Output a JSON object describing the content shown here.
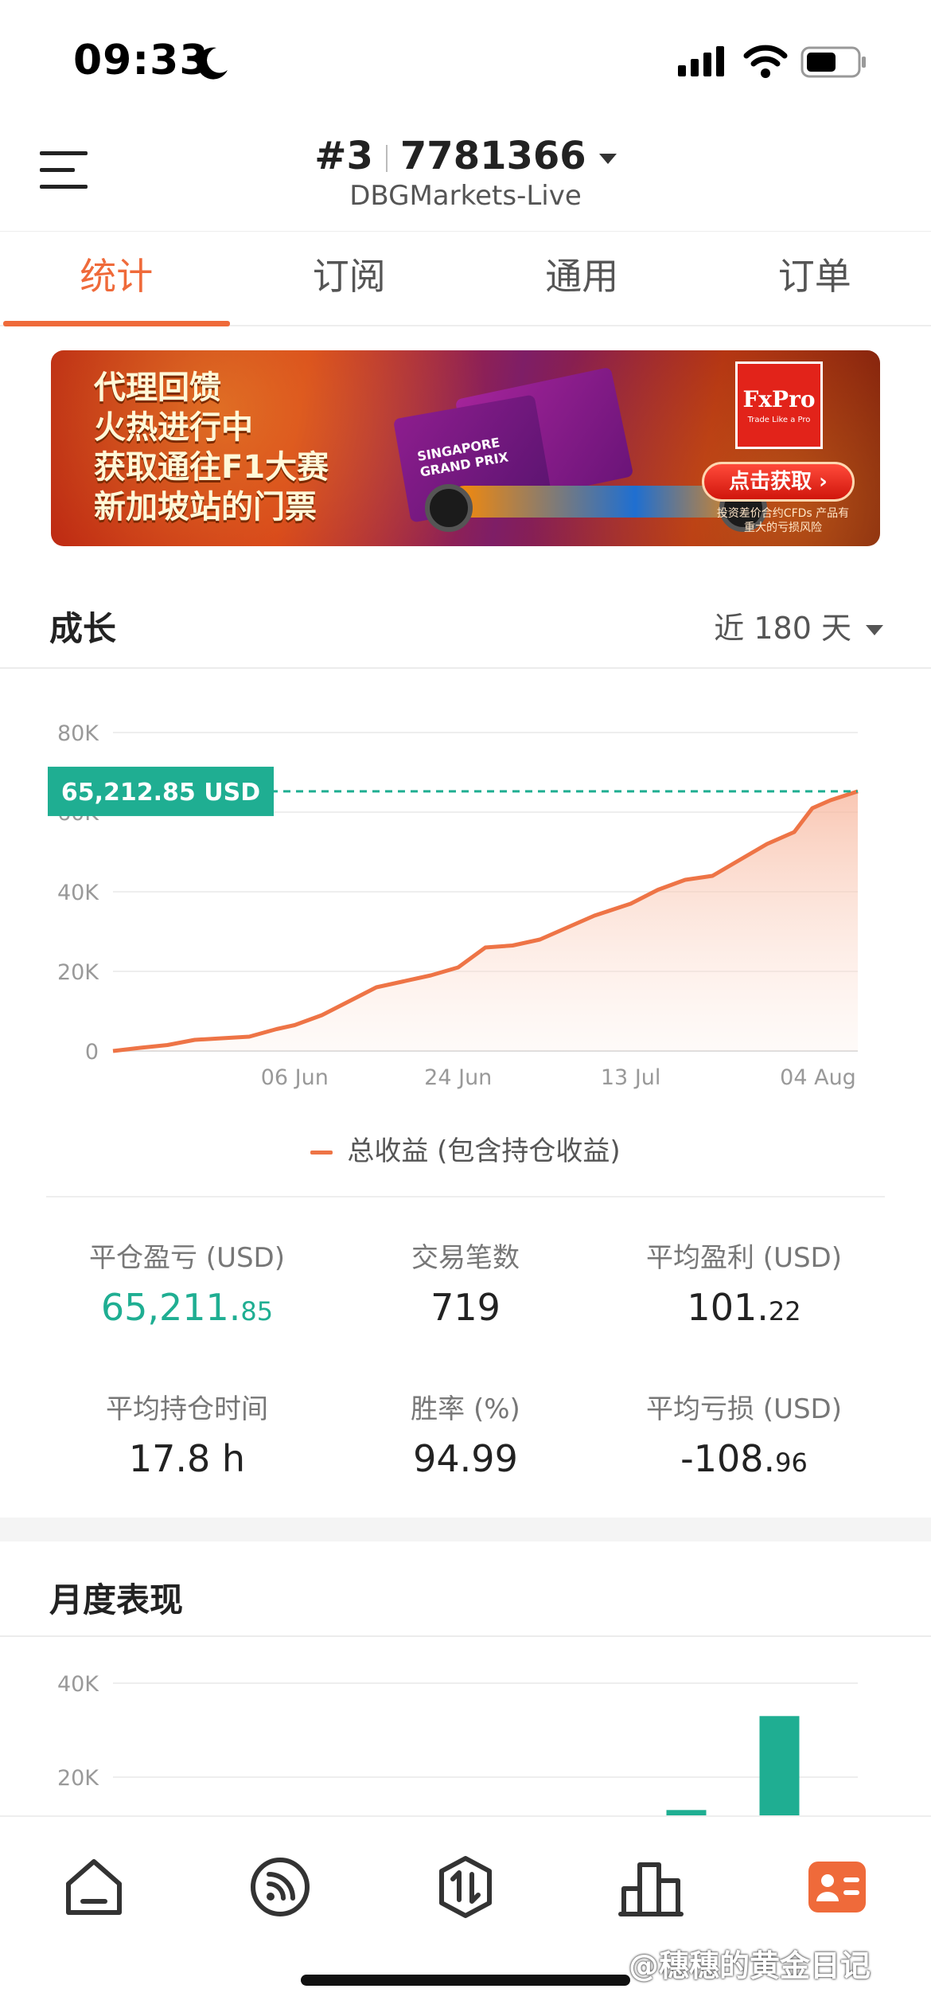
{
  "status_bar": {
    "time": "09:33"
  },
  "header": {
    "account_index": "#3",
    "account_number": "7781366",
    "server": "DBGMarkets-Live"
  },
  "tabs": [
    {
      "label": "统计",
      "active": true
    },
    {
      "label": "订阅",
      "active": false
    },
    {
      "label": "通用",
      "active": false
    },
    {
      "label": "订单",
      "active": false
    }
  ],
  "banner": {
    "lines": [
      "代理回馈",
      "火热进行中",
      "获取通往F1大赛",
      "新加坡站的门票"
    ],
    "ticket_text": "SINGAPORE GRAND PRIX",
    "brand": "FxPro",
    "brand_tagline": "Trade Like a Pro",
    "cta": "点击获取 ›",
    "risk": "投资差价合约CFDs 产品有重大的亏损风险"
  },
  "growth": {
    "title": "成长",
    "range": "近 180 天",
    "current_value_label": "65,212.85 USD",
    "legend": "总收益 (包含持仓收益)"
  },
  "chart_data": [
    {
      "type": "area",
      "title": "",
      "xlabel": "",
      "ylabel": "",
      "ylim": [
        0,
        80000
      ],
      "yticks": [
        "0",
        "20K",
        "40K",
        "60K",
        "80K"
      ],
      "xticks": [
        "06 Jun",
        "24 Jun",
        "13 Jul",
        "04 Aug"
      ],
      "grid": true,
      "line_color": "#ee7446",
      "marker_color": "#1fae92",
      "series": [
        {
          "name": "总收益 (包含持仓收益)",
          "x": [
            "2023-05-17",
            "2023-05-20",
            "2023-05-23",
            "2023-05-26",
            "2023-05-29",
            "2023-06-01",
            "2023-06-04",
            "2023-06-06",
            "2023-06-09",
            "2023-06-12",
            "2023-06-15",
            "2023-06-18",
            "2023-06-21",
            "2023-06-24",
            "2023-06-27",
            "2023-06-30",
            "2023-07-03",
            "2023-07-06",
            "2023-07-09",
            "2023-07-13",
            "2023-07-16",
            "2023-07-19",
            "2023-07-22",
            "2023-07-25",
            "2023-07-28",
            "2023-07-31",
            "2023-08-02",
            "2023-08-04",
            "2023-08-07"
          ],
          "values": [
            0,
            800,
            1500,
            2800,
            3200,
            3600,
            5500,
            6500,
            9000,
            12500,
            16000,
            17500,
            19000,
            21000,
            26000,
            26500,
            28000,
            31000,
            34000,
            37000,
            40500,
            43000,
            44000,
            48000,
            52000,
            55000,
            61000,
            63000,
            65212.85
          ]
        }
      ]
    },
    {
      "type": "bar",
      "title": "",
      "ylim": [
        0,
        40000
      ],
      "yticks": [
        "20K",
        "40K"
      ],
      "bar_color": "#1fae92",
      "categories": [
        "",
        "",
        "",
        "",
        "",
        "",
        "",
        ""
      ],
      "series": [
        {
          "values": [
            0,
            0,
            0,
            0,
            0,
            0,
            13000,
            33000
          ]
        }
      ]
    }
  ],
  "stats": {
    "items": [
      {
        "label": "平仓盈亏 (USD)",
        "int": "65,211.",
        "dec": "85",
        "highlight": true
      },
      {
        "label": "交易笔数",
        "int": "719",
        "dec": "",
        "highlight": false
      },
      {
        "label": "平均盈利 (USD)",
        "int": "101.",
        "dec": "22",
        "highlight": false
      },
      {
        "label": "平均持仓时间",
        "int": "17.8 h",
        "dec": "",
        "highlight": false
      },
      {
        "label": "胜率 (%)",
        "int": "94.99",
        "dec": "",
        "highlight": false
      },
      {
        "label": "平均亏损 (USD)",
        "int": "-108.",
        "dec": "96",
        "highlight": false
      }
    ]
  },
  "monthly": {
    "title": "月度表现"
  },
  "bottom_nav": {
    "items": [
      {
        "icon": "home-icon",
        "active": false
      },
      {
        "icon": "signal-feed-icon",
        "active": false
      },
      {
        "icon": "trade-icon",
        "active": false
      },
      {
        "icon": "stats-bar-icon",
        "active": false
      },
      {
        "icon": "profile-card-icon",
        "active": true
      }
    ]
  },
  "watermark": "@穗穗的黄金日记",
  "colors": {
    "accent": "#ef6a3a",
    "green": "#1fae92",
    "line": "#ee7446"
  }
}
